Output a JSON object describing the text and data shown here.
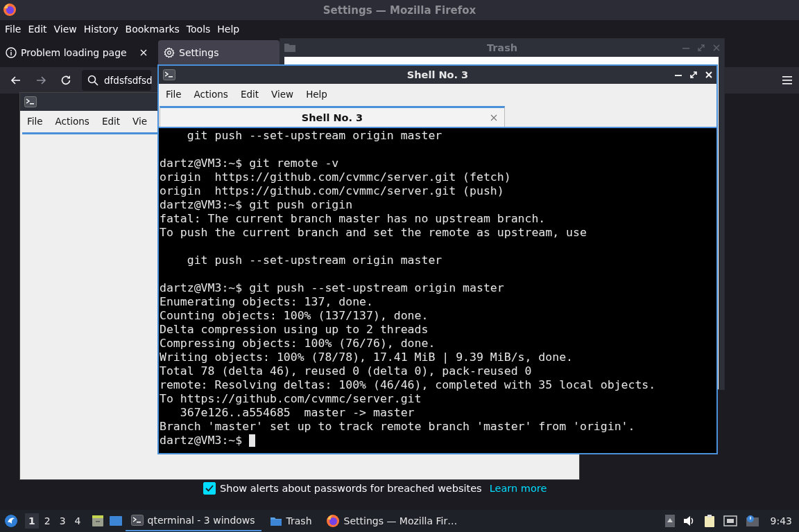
{
  "firefox": {
    "title": "Settings — Mozilla Firefox",
    "menu": [
      "File",
      "Edit",
      "View",
      "History",
      "Bookmarks",
      "Tools",
      "Help"
    ],
    "tabs": [
      {
        "label": "Problem loading page",
        "selected": false
      },
      {
        "label": "Settings",
        "selected": true
      }
    ],
    "nav_buttons": [
      {
        "kind": "back",
        "disabled": false
      },
      {
        "kind": "forward",
        "disabled": true
      },
      {
        "kind": "reload",
        "disabled": false
      }
    ],
    "url": {
      "value": "dfdsfsdfsd"
    },
    "settings": {
      "checkbox": {
        "label": "Show alerts about passwords for breached websites",
        "checked": true
      },
      "link": "Learn more"
    }
  },
  "trash_window": {
    "title": "Trash"
  },
  "back_terminal": {
    "menu": [
      "File",
      "Actions",
      "Edit",
      "Vie"
    ]
  },
  "shell_window": {
    "title": "Shell No. 3",
    "menu": [
      "File",
      "Actions",
      "Edit",
      "View",
      "Help"
    ],
    "tabs": [
      {
        "label": "Shell No. 3",
        "selected": true
      }
    ],
    "output_blocks": [
      [
        "    git push --set-upstream origin master"
      ],
      [
        "dartz@VM3:~$ git remote -v",
        "origin  https://github.com/cvmmc/server.git (fetch)",
        "origin  https://github.com/cvmmc/server.git (push)",
        "dartz@VM3:~$ git push origin",
        "fatal: The current branch master has no upstream branch.",
        "To push the current branch and set the remote as upstream, use"
      ],
      [
        "    git push --set-upstream origin master"
      ],
      [
        "dartz@VM3:~$ git push --set-upstream origin master",
        "Enumerating objects: 137, done.",
        "Counting objects: 100% (137/137), done.",
        "Delta compression using up to 2 threads",
        "Compressing objects: 100% (76/76), done.",
        "Writing objects: 100% (78/78), 17.41 MiB | 9.39 MiB/s, done.",
        "Total 78 (delta 46), reused 0 (delta 0), pack-reused 0",
        "remote: Resolving deltas: 100% (46/46), completed with 35 local objects.",
        "To https://github.com/cvmmc/server.git",
        "   367e126..a554685  master -> master",
        "Branch 'master' set up to track remote branch 'master' from 'origin'.",
        "dartz@VM3:~$"
      ]
    ]
  },
  "taskbar": {
    "desktops": [
      {
        "label": "1",
        "selected": true
      },
      {
        "label": "2",
        "selected": false
      },
      {
        "label": "3",
        "selected": false
      },
      {
        "label": "4",
        "selected": false
      }
    ],
    "tasks": [
      {
        "label": "qterminal - 3 windows",
        "selected": true
      },
      {
        "label": "Trash",
        "selected": false
      },
      {
        "label": "Settings — Mozilla Fir…",
        "selected": false
      }
    ],
    "clock": "9:43"
  }
}
